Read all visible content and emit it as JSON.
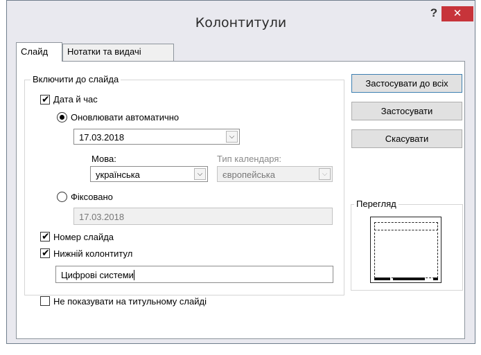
{
  "window": {
    "title": "Колонтитули",
    "help_label": "?",
    "close_label": "✕"
  },
  "tabs": [
    {
      "label": "Слайд",
      "active": true
    },
    {
      "label": "Нотатки та видачі",
      "active": false
    }
  ],
  "include_group": {
    "label": "Включити до слайда",
    "date_time": {
      "label": "Дата й час",
      "checked": true
    },
    "auto_update": {
      "label": "Оновлювати автоматично",
      "selected": true
    },
    "date_value": "17.03.2018",
    "language": {
      "label": "Мова:",
      "value": "українська"
    },
    "calendar_type": {
      "label": "Тип календаря:",
      "value": "європейська",
      "enabled": false
    },
    "fixed": {
      "label": "Фіксовано",
      "selected": false,
      "value": "17.03.2018"
    },
    "slide_number": {
      "label": "Номер слайда",
      "checked": true
    },
    "footer": {
      "label": "Нижній колонтитул",
      "checked": true,
      "value": "Цифрові системи"
    }
  },
  "dont_show_title": {
    "label": "Не показувати на титульному слайді",
    "checked": false
  },
  "buttons": {
    "apply_all": "Застосувати до всіх",
    "apply": "Застосувати",
    "cancel": "Скасувати"
  },
  "preview": {
    "label": "Перегляд"
  },
  "icons": {
    "help": "question-mark-icon",
    "close": "close-x-icon",
    "dropdown": "chevron-down-icon",
    "check": "checkmark-icon"
  },
  "colors": {
    "close_button": "#c7343a",
    "dialog_bg": "#e9e9ef",
    "default_button_border": "#3c7fb1"
  }
}
